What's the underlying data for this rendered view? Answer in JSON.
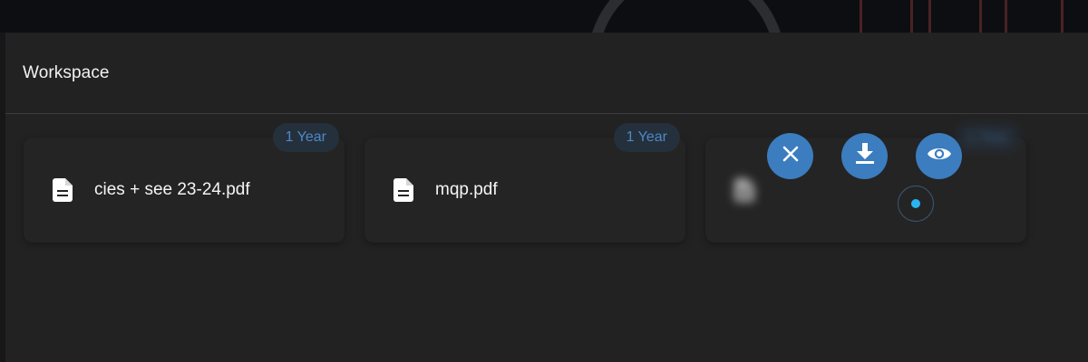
{
  "panel": {
    "title": "Workspace"
  },
  "files": [
    {
      "name": "cies + see 23-24.pdf",
      "retention": "1 Year",
      "icon": "file-document-icon"
    },
    {
      "name": "mqp.pdf",
      "retention": "1 Year",
      "icon": "file-document-icon"
    },
    {
      "name": "",
      "retention": "1 Year",
      "icon": "file-document-icon"
    }
  ],
  "actions": {
    "close_icon": "close-icon",
    "download_icon": "download-icon",
    "view_icon": "eye-icon"
  },
  "colors": {
    "accent": "#3b7dbf",
    "badge_text": "#4e88c6",
    "badge_bg": "#25303d",
    "indicator": "#2ab5f0"
  }
}
